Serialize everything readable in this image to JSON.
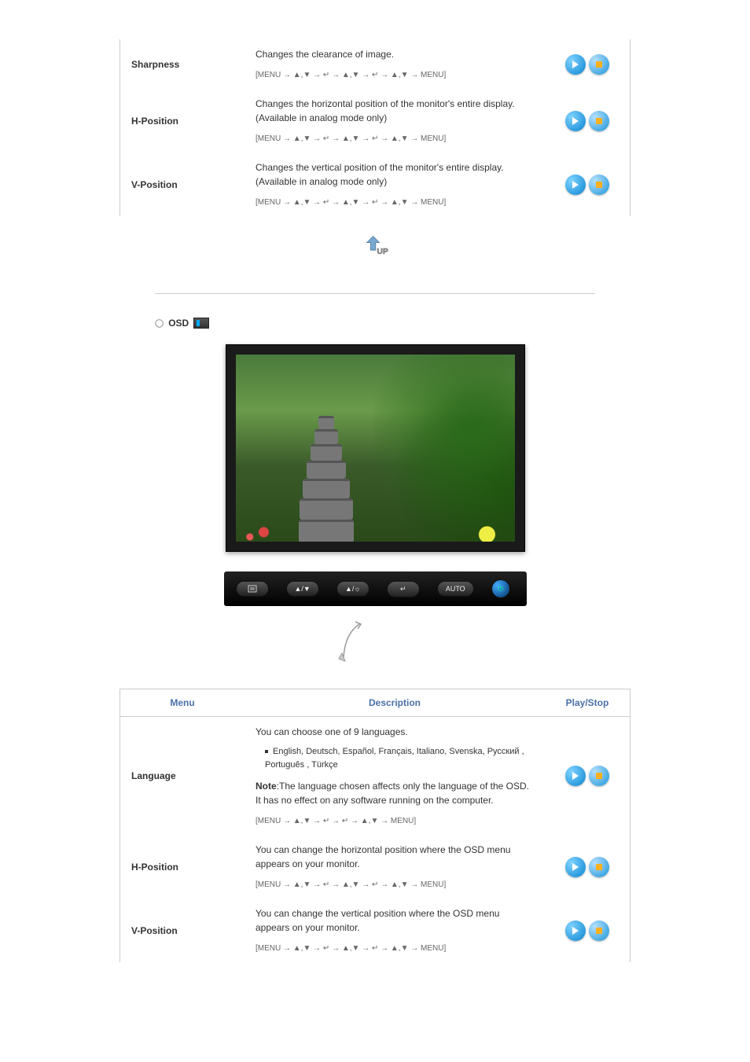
{
  "top_table": [
    {
      "name": "Sharpness",
      "desc": "Changes the clearance of image.",
      "note": "",
      "seq": "[MENU → ▲,▼ → ↵ → ▲,▼ → ↵ → ▲,▼ → MENU]"
    },
    {
      "name": "H-Position",
      "desc": "Changes the horizontal position of the monitor's entire display.",
      "note": "(Available in analog mode only)",
      "seq": "[MENU → ▲,▼ → ↵ → ▲,▼ → ↵ → ▲,▼ → MENU]"
    },
    {
      "name": "V-Position",
      "desc": "Changes the vertical position of the monitor's entire display.",
      "note": "(Available in analog mode only)",
      "seq": "[MENU → ▲,▼ → ↵ → ▲,▼ → ↵ → ▲,▼ → MENU]"
    }
  ],
  "osd_heading": "OSD",
  "controls": {
    "menu": "MENU",
    "auto": "AUTO"
  },
  "headers": {
    "menu": "Menu",
    "description": "Description",
    "playstop": "Play/Stop"
  },
  "bottom_table": {
    "language": {
      "name": "Language",
      "intro": "You can choose one of 9 languages.",
      "list": "English, Deutsch, Español, Français, Italiano, Svenska, Русский , Português , Türkçe",
      "note_label": "Note",
      "note_text": ":The language chosen affects only the language of the OSD. It has no effect on any software running on the computer.",
      "seq": "[MENU → ▲,▼ → ↵ → ↵ → ▲,▼ → MENU]"
    },
    "hpos": {
      "name": "H-Position",
      "desc": "You can change the horizontal position where the OSD menu appears on your monitor.",
      "seq": "[MENU → ▲,▼ → ↵ → ▲,▼ → ↵ → ▲,▼ → MENU]"
    },
    "vpos": {
      "name": "V-Position",
      "desc": "You can change the vertical position where the OSD menu appears on your monitor.",
      "seq": "[MENU → ▲,▼ → ↵ → ▲,▼ → ↵ → ▲,▼ → MENU]"
    }
  }
}
